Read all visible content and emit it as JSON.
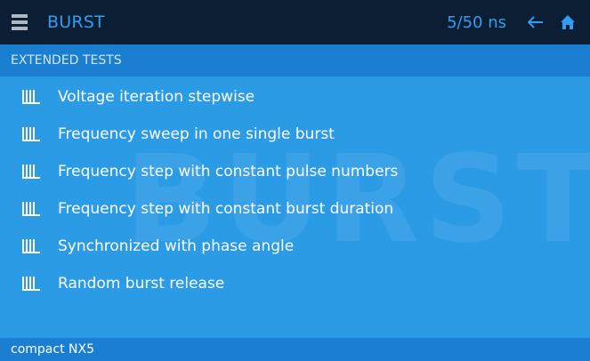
{
  "header": {
    "title": "BURST",
    "pulse_value": "5/50 ns",
    "icons": {
      "menu": "menu-icon",
      "back": "arrow-left-icon",
      "home": "home-icon"
    }
  },
  "section": {
    "title": "EXTENDED TESTS"
  },
  "watermark": "BURST",
  "list": {
    "item_icon": "burst-pulse-icon",
    "items": [
      {
        "label": "Voltage iteration stepwise"
      },
      {
        "label": "Frequency sweep in one single burst"
      },
      {
        "label": "Frequency step with constant pulse numbers"
      },
      {
        "label": "Frequency step with constant burst duration"
      },
      {
        "label": "Synchronized with phase angle"
      },
      {
        "label": "Random burst release"
      }
    ]
  },
  "footer": {
    "device_name": "compact NX5"
  },
  "colors": {
    "topbar_bg": "#0b1e34",
    "accent": "#2f9ef0",
    "content_bg": "#2b9be6",
    "section_bg": "#1a7fd0",
    "text": "#ffffff"
  }
}
